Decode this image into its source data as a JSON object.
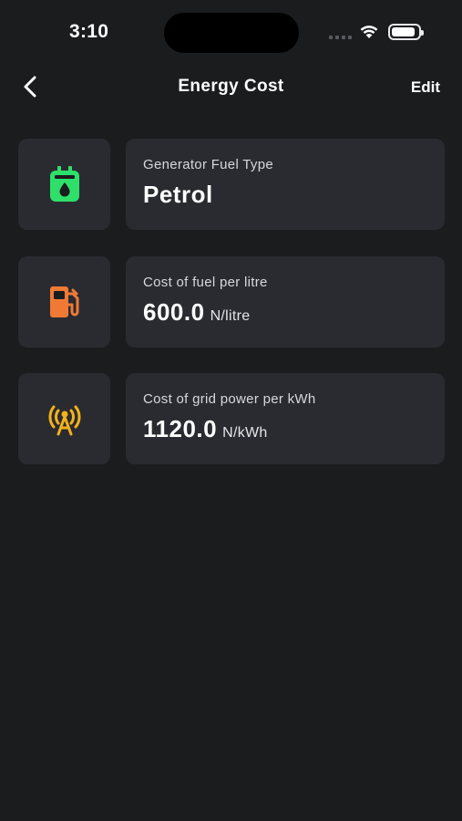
{
  "status_bar": {
    "time": "3:10",
    "battery_level": 0.9
  },
  "nav": {
    "title": "Energy Cost",
    "edit_label": "Edit",
    "back_icon": "chevron-left-icon"
  },
  "items": [
    {
      "icon": "generator-fuel-icon",
      "icon_color": "#2ee06a",
      "label": "Generator Fuel Type",
      "value": "Petrol",
      "unit": ""
    },
    {
      "icon": "fuel-pump-icon",
      "icon_color": "#f07a35",
      "label": "Cost of fuel per litre",
      "value": "600.0",
      "unit": "N/litre"
    },
    {
      "icon": "grid-tower-icon",
      "icon_color": "#f3b21c",
      "label": "Cost of grid power per kWh",
      "value": "1120.0",
      "unit": "N/kWh"
    }
  ]
}
